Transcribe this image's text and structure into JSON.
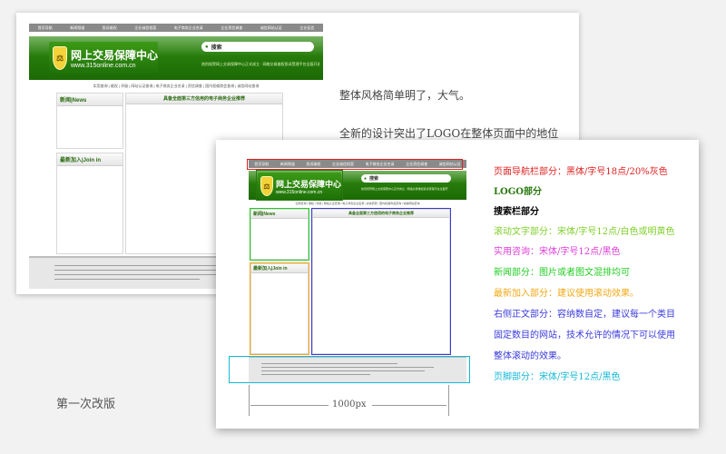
{
  "site": {
    "nav_items": [
      "首页导航",
      "新闻频道",
      "投诉维权",
      "企业诚信档案",
      "电子商务企业名录",
      "企业资信调查",
      "诚信网站认证",
      "企业征信",
      "会员服务"
    ],
    "logo_title": "网上交易保障中心",
    "logo_url": "www.315online.com.cn",
    "search_label": "搜索",
    "scroll_text": "热烈祝贺网上交易保障中心正式成立 · 网络交易维权投诉受理平台全面开通",
    "practical_text": "实用查询 | 维权 | 评级 | 网站认证查询 | 电子商务企业名录 | 资信调查 | 国内权威商会查询 | 诚信网站查询",
    "news_head": "新闻|News",
    "join_head": "最新加入|Join in",
    "main_head": "具备全面第三方信用的电子商务企业推荐",
    "footer_lines": [
      "版权所有 · 网上交易保障中心",
      "中国电子商务协会 · 网络信用与网络安全工作委员会"
    ]
  },
  "annotations": {
    "intro1": "整体风格简单明了，大气。",
    "intro2": "全新的设计突出了LOGO在整体页面中的地位",
    "nav": "页面导航栏部分：黑体/字号18点/20%灰色",
    "logo": "LOGO部分",
    "search": "搜索栏部分",
    "scroll": "滚动文字部分：宋体/字号12点/白色或明黄色",
    "practical": "实用咨询：宋体/字号12点/黑色",
    "news": "新闻部分：图片或者图文混排均可",
    "join": "最新加入部分：建议使用滚动效果。",
    "right1": "右侧正文部分：容纳数自定，建议每一个类目",
    "right2": "固定数目的网站，技术允许的情况下可以使用",
    "right3": "整体滚动的效果。",
    "footer": "页脚部分：宋体/字号12点/黑色",
    "width_label": "1000px",
    "caption": "第一次改版"
  },
  "colors": {
    "nav": "#e02020",
    "logo": "#2a7a10",
    "search": "#000000",
    "scroll": "#7fcf2a",
    "practical": "#e03bd8",
    "news": "#22cc22",
    "join": "#f2a814",
    "right": "#3a3adc",
    "footer": "#14b8d8"
  }
}
